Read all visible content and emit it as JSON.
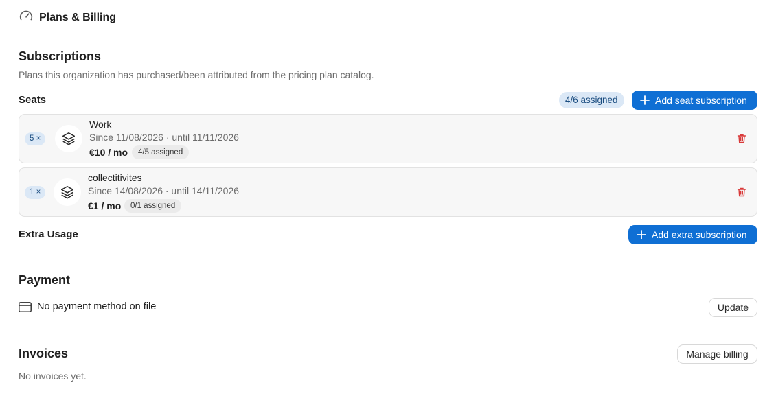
{
  "header": {
    "title": "Plans & Billing",
    "icon": "gauge-icon"
  },
  "subscriptions": {
    "title": "Subscriptions",
    "description": "Plans this organization has purchased/been attributed from the pricing plan catalog.",
    "seats": {
      "label": "Seats",
      "assigned_summary": "4/6 assigned",
      "add_button": "Add seat subscription",
      "items": [
        {
          "quantity": "5 ×",
          "name": "Work",
          "dates": "Since 11/08/2026 · until 11/11/2026",
          "price": "€10 / mo",
          "assigned": "4/5 assigned",
          "icon": "layers-icon"
        },
        {
          "quantity": "1 ×",
          "name": "collectitivites",
          "dates": "Since 14/08/2026 · until 14/11/2026",
          "price": "€1 / mo",
          "assigned": "0/1 assigned",
          "icon": "layers-icon"
        }
      ]
    },
    "extra_usage": {
      "label": "Extra Usage",
      "add_button": "Add extra subscription"
    }
  },
  "payment": {
    "title": "Payment",
    "status": "No payment method on file",
    "update_button": "Update",
    "icon": "credit-card-icon"
  },
  "invoices": {
    "title": "Invoices",
    "manage_button": "Manage billing",
    "empty_text": "No invoices yet."
  },
  "colors": {
    "primary": "#0f6fd4",
    "badge_bg": "#dbe8f6",
    "badge_text": "#1b4d80",
    "danger": "#d93a3a",
    "card_bg": "#f7f7f7"
  }
}
